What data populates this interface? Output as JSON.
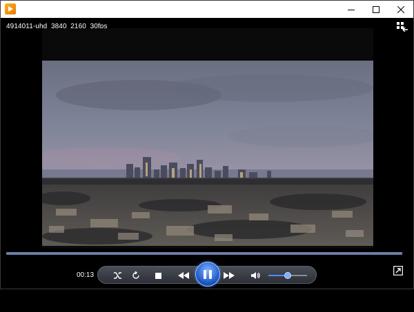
{
  "window": {
    "title_text": "",
    "app_icon": "media-player-icon",
    "controls": [
      "minimize-icon",
      "maximize-icon",
      "close-icon"
    ]
  },
  "media": {
    "title": "4914011-uhd_3840_2160_30fps",
    "current_time": "00:13",
    "progress": 0.0
  },
  "playback": {
    "state": "playing",
    "volume": 0.5
  },
  "icons": {
    "switch_view": "switch-to-library-icon",
    "shuffle": "shuffle-icon",
    "repeat": "repeat-icon",
    "stop": "stop-icon",
    "previous": "previous-icon",
    "play_pause": "pause-icon",
    "next": "next-icon",
    "volume": "volume-icon",
    "fullscreen": "fullscreen-icon"
  },
  "colors": {
    "seek_track": "#6b7fa6",
    "accent": "#3f6fd6",
    "titlebar": "#ffffff"
  }
}
